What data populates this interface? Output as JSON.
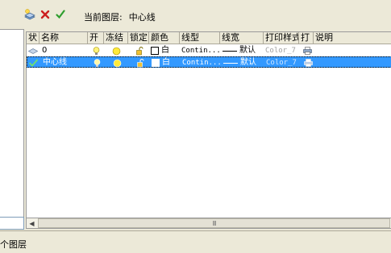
{
  "toolbar": {
    "new_icon": "new-layer-icon",
    "delete_icon": "delete-layer-icon",
    "set_current_icon": "set-current-icon"
  },
  "current_layer": {
    "label": "当前图层:",
    "value": "中心线"
  },
  "columns": {
    "status": "状",
    "name": "名称",
    "on": "开",
    "freeze": "冻结",
    "lock": "锁定",
    "color": "颜色",
    "linetype": "线型",
    "lineweight": "线宽",
    "plotstyle": "打印样式",
    "plot": "打",
    "description": "说明"
  },
  "layers": [
    {
      "status_icon": "layer-icon",
      "name": "0",
      "on": true,
      "frozen": false,
      "locked": false,
      "color": "白",
      "linetype": "Contin...",
      "lineweight": "默认",
      "plotstyle": "Color_7",
      "plot": true,
      "description": "",
      "selected": false
    },
    {
      "status_icon": "current-check-icon",
      "name": "中心线",
      "on": true,
      "frozen": false,
      "locked": false,
      "color": "白",
      "linetype": "Contin...",
      "lineweight": "默认",
      "plotstyle": "Color_7",
      "plot": true,
      "description": "",
      "selected": true
    }
  ],
  "scrollbar": {
    "grip": "III"
  },
  "status_bar": {
    "text": "个图层"
  },
  "colors": {
    "selection": "#3399ff",
    "panel": "#ece9d8",
    "delete_red": "#cc1f1f",
    "check_green": "#2e9e2e"
  }
}
